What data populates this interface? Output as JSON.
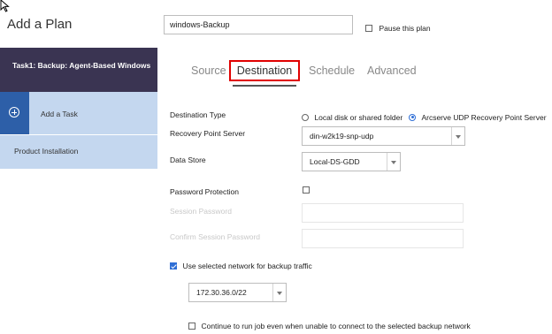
{
  "header": {
    "title": "Add a Plan",
    "plan_name": "windows-Backup",
    "pause_label": "Pause this plan"
  },
  "sidebar": {
    "task_label": "Task1: Backup: Agent-Based Windows",
    "add_task": "Add a Task",
    "product_installation": "Product Installation"
  },
  "tabs": {
    "source": "Source",
    "destination": "Destination",
    "schedule": "Schedule",
    "advanced": "Advanced"
  },
  "form": {
    "destination_type_label": "Destination Type",
    "local_disk_label": "Local disk or shared folder",
    "rps_option_label": "Arcserve UDP Recovery Point Server",
    "rps_label": "Recovery Point Server",
    "rps_value": "din-w2k19-snp-udp",
    "data_store_label": "Data Store",
    "data_store_value": "Local-DS-GDD",
    "password_protection_label": "Password Protection",
    "session_password_label": "Session Password",
    "confirm_password_label": "Confirm Session Password",
    "use_network_label": "Use selected network for backup traffic",
    "network_value": "172.30.36.0/22",
    "continue_label": "Continue to run job even when unable to connect to the selected backup network"
  }
}
